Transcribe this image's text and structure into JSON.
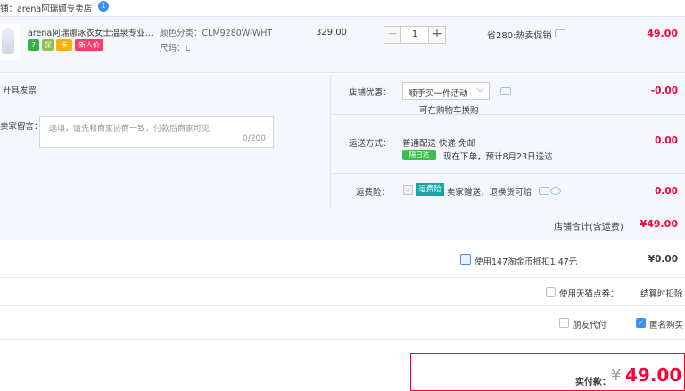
{
  "store": {
    "name": "铺：arena阿瑞娜专卖店",
    "chat_badge": "1"
  },
  "item": {
    "title": "arena阿瑞娜泳衣女士温泉专业...",
    "badges": [
      "7",
      "保",
      "卡",
      "新人价"
    ],
    "sku_color_label": "颜色分类：",
    "sku_color_value": "CLM9280W-WHT",
    "sku_size_label": "尺码：",
    "sku_size_value": "L",
    "price": "329.00",
    "quantity": "1",
    "minus": "−",
    "plus": "+",
    "savings": "省280:热卖促销",
    "total": "49.00"
  },
  "options": {
    "invoice_label": "开具发票",
    "message_label": "卖家留言：",
    "message_placeholder": "选填，请先和商家协商一致，付款后商家可见",
    "message_count": "0/200",
    "store_discount_label": "店铺优惠：",
    "store_discount_value": "顺手买一件活动",
    "store_discount_note": "可在购物车换购",
    "store_discount_amount": "-0.00",
    "shipping_label": "运送方式：",
    "shipping_value": "普通配送 快递 免邮",
    "shipping_tag": "隔日达",
    "shipping_eta": "现在下单，预计8月23日送达",
    "shipping_amount": "0.00",
    "insurance_label": "运费险：",
    "insurance_tag": "运费险",
    "insurance_text": "卖家赠送，退换货可赔",
    "insurance_amount": "0.00"
  },
  "store_total": {
    "label": "店铺合计(含运费)",
    "value": "¥49.00"
  },
  "taobao_coins": {
    "label": "使用147淘金币抵扣1.47元",
    "value": "¥0.00"
  },
  "tmall_points": {
    "label": "使用天猫点券：",
    "note": "结算时扣除"
  },
  "payment_opts": {
    "friend_pay": "朋友代付",
    "anonymous": "匿名购买"
  },
  "payment": {
    "label": "实付款：",
    "currency": "¥",
    "amount": "49.00"
  },
  "colors": {
    "accent_red": "#ff0036",
    "accent_blue": "#3b8ef2"
  }
}
